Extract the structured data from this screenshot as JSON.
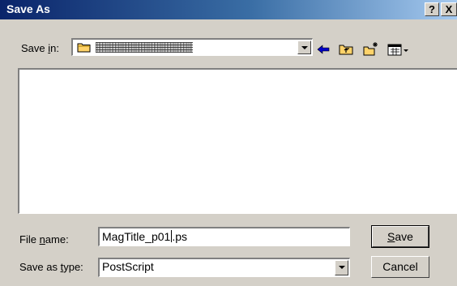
{
  "window": {
    "title": "Save As",
    "help_label": "?",
    "close_label": "X"
  },
  "save_in": {
    "label_pre": "Save ",
    "label_mnemonic": "i",
    "label_post": "n:",
    "value_obscured": true
  },
  "toolbar": {
    "icons": [
      "back-arrow-icon",
      "up-folder-icon",
      "new-folder-icon",
      "view-menu-icon"
    ]
  },
  "file_name": {
    "label_pre": "File ",
    "label_mnemonic": "n",
    "label_post": "ame:",
    "value_before_caret": "MagTitle_p01",
    "value_after_caret": ".ps"
  },
  "save_as_type": {
    "label_pre": "Save as ",
    "label_mnemonic": "t",
    "label_post": "ype:",
    "value": "PostScript"
  },
  "buttons": {
    "save_mnemonic": "S",
    "save_rest": "ave",
    "cancel": "Cancel"
  },
  "colors": {
    "title_gradient_start": "#0a246a",
    "title_gradient_end": "#a6caf0",
    "face": "#d4d0c8",
    "folder": "#ffd36a",
    "arrow": "#0000c8"
  }
}
